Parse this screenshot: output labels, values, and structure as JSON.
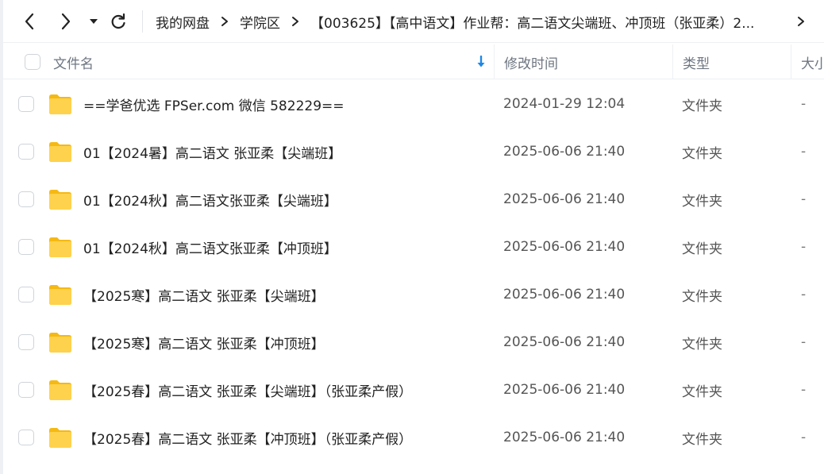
{
  "toolbar": {
    "back_icon": "chevron-left-icon",
    "forward_icon": "chevron-right-icon",
    "dropdown_icon": "caret-down-icon",
    "refresh_icon": "refresh-icon",
    "breadcrumb": [
      "我的网盘",
      "学院区",
      "【003625】【高中语文】作业帮：高二语文尖端班、冲顶班（张亚柔）2..."
    ],
    "more_icon": "chevron-right-icon"
  },
  "table": {
    "columns": {
      "name": "文件名",
      "modified": "修改时间",
      "type": "类型",
      "size": "大小"
    },
    "sort_icon": "arrow-down-icon",
    "sort_color": "#1e88e5",
    "folder_color": "#f7c531",
    "rows": [
      {
        "name": "==学爸优选 FPSer.com 微信 582229==",
        "modified": "2024-01-29 12:04",
        "type": "文件夹",
        "size": "-"
      },
      {
        "name": "01【2024暑】高二语文 张亚柔【尖端班】",
        "modified": "2025-06-06 21:40",
        "type": "文件夹",
        "size": "-"
      },
      {
        "name": "01【2024秋】高二语文张亚柔【尖端班】",
        "modified": "2025-06-06 21:40",
        "type": "文件夹",
        "size": "-"
      },
      {
        "name": "01【2024秋】高二语文张亚柔【冲顶班】",
        "modified": "2025-06-06 21:40",
        "type": "文件夹",
        "size": "-"
      },
      {
        "name": "【2025寒】高二语文 张亚柔【尖端班】",
        "modified": "2025-06-06 21:40",
        "type": "文件夹",
        "size": "-"
      },
      {
        "name": "【2025寒】高二语文 张亚柔【冲顶班】",
        "modified": "2025-06-06 21:40",
        "type": "文件夹",
        "size": "-"
      },
      {
        "name": "【2025春】高二语文 张亚柔【尖端班】（张亚柔产假）",
        "modified": "2025-06-06 21:40",
        "type": "文件夹",
        "size": "-"
      },
      {
        "name": "【2025春】高二语文 张亚柔【冲顶班】（张亚柔产假）",
        "modified": "2025-06-06 21:40",
        "type": "文件夹",
        "size": "-"
      }
    ]
  }
}
